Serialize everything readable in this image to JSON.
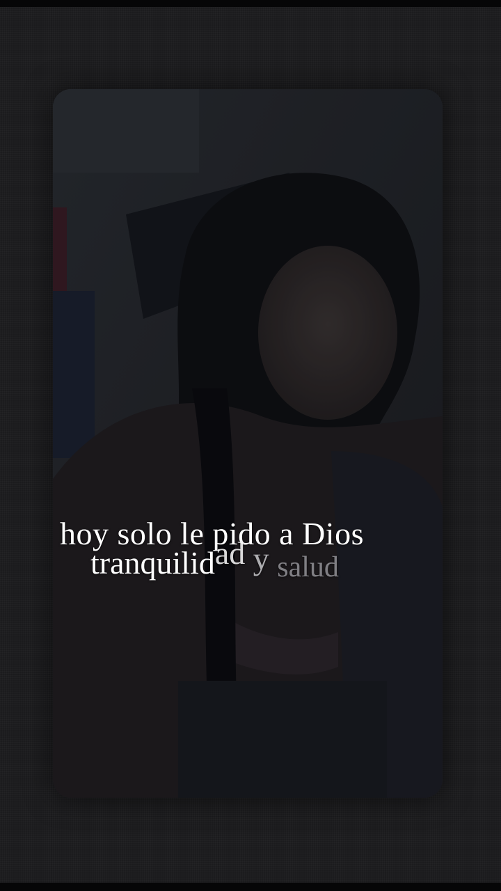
{
  "caption": {
    "line1": "hoy solo le pido a Dios",
    "line2_part1": "tranquilid",
    "line2_part2": "ad",
    "line2_part3": "y",
    "line2_part4": "salud"
  },
  "colors": {
    "background": "#1b1b1d",
    "caption_text": "#ffffff"
  }
}
